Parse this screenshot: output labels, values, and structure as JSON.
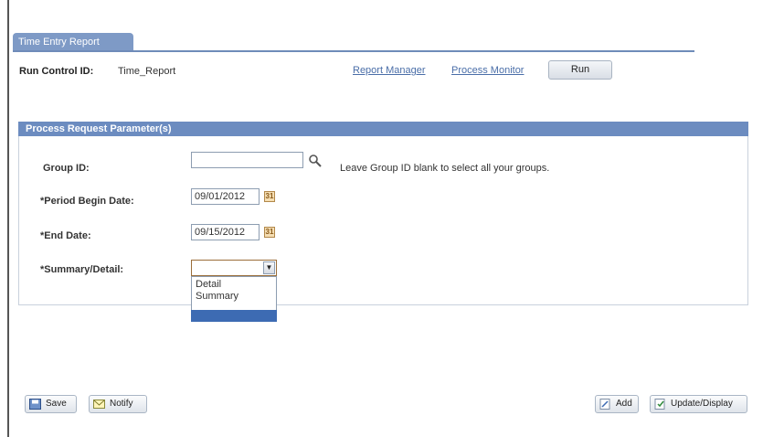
{
  "tab": {
    "label": "Time Entry Report"
  },
  "run_control": {
    "label": "Run Control ID:",
    "value": "Time_Report",
    "links": {
      "report_manager": "Report Manager",
      "process_monitor": "Process Monitor"
    },
    "run_label": "Run"
  },
  "panel": {
    "title": "Process Request Parameter(s)",
    "group_id": {
      "label": "Group ID:",
      "value": "",
      "hint": "Leave Group ID blank to select all your groups."
    },
    "period_begin": {
      "label": "*Period Begin Date:",
      "value": "09/01/2012"
    },
    "end_date": {
      "label": "*End Date:",
      "value": "09/15/2012"
    },
    "summary_detail": {
      "label": "*Summary/Detail:",
      "value": "",
      "options": [
        "Detail",
        "Summary"
      ]
    }
  },
  "footer": {
    "save_label": "Save",
    "notify_label": "Notify",
    "add_label": "Add",
    "update_label": "Update/Display"
  },
  "colors": {
    "tab": "#7e9ac6",
    "header": "#6c8cc0",
    "link": "#4a6ea8",
    "selected": "#3d6bb3"
  },
  "icons": {
    "group_lookup": "search-icon",
    "calendar": "calendar-icon",
    "dropdown": "chevron-down-icon"
  }
}
